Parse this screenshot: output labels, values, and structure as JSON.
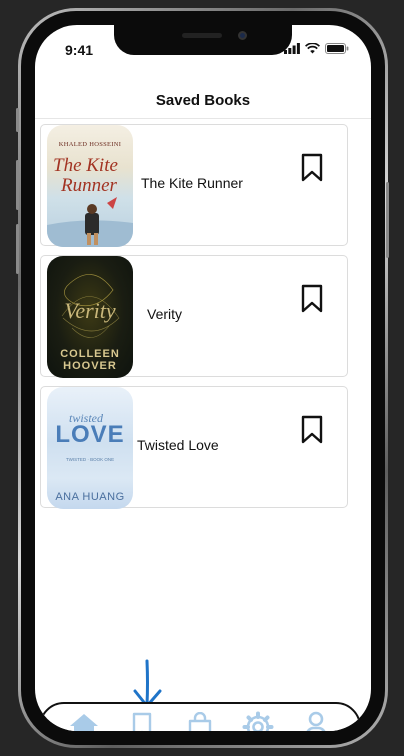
{
  "status_bar": {
    "time": "9:41"
  },
  "header": {
    "title": "Saved Books"
  },
  "books": [
    {
      "title": "The Kite Runner",
      "cover": {
        "author": "KHALED HOSSEINI",
        "title_line1": "The Kite",
        "title_line2": "Runner"
      }
    },
    {
      "title": "Verity",
      "cover": {
        "title": "Verity",
        "author_line1": "COLLEEN",
        "author_line2": "HOOVER"
      }
    },
    {
      "title": "Twisted Love",
      "cover": {
        "script": "twisted",
        "title": "LOVE",
        "series": "TWISTED · BOOK ONE",
        "author": "ANA HUANG"
      }
    }
  ],
  "bottom_nav": {
    "items": [
      "home-icon",
      "bookmark-icon",
      "shopping-bag-icon",
      "gear-icon",
      "user-icon"
    ],
    "active": "bookmark-icon",
    "icon_color": "#a9cbe8"
  },
  "colors": {
    "frame_background": "#262626",
    "screen_background": "#ffffff",
    "annotation_arrow": "#1f74c8"
  }
}
